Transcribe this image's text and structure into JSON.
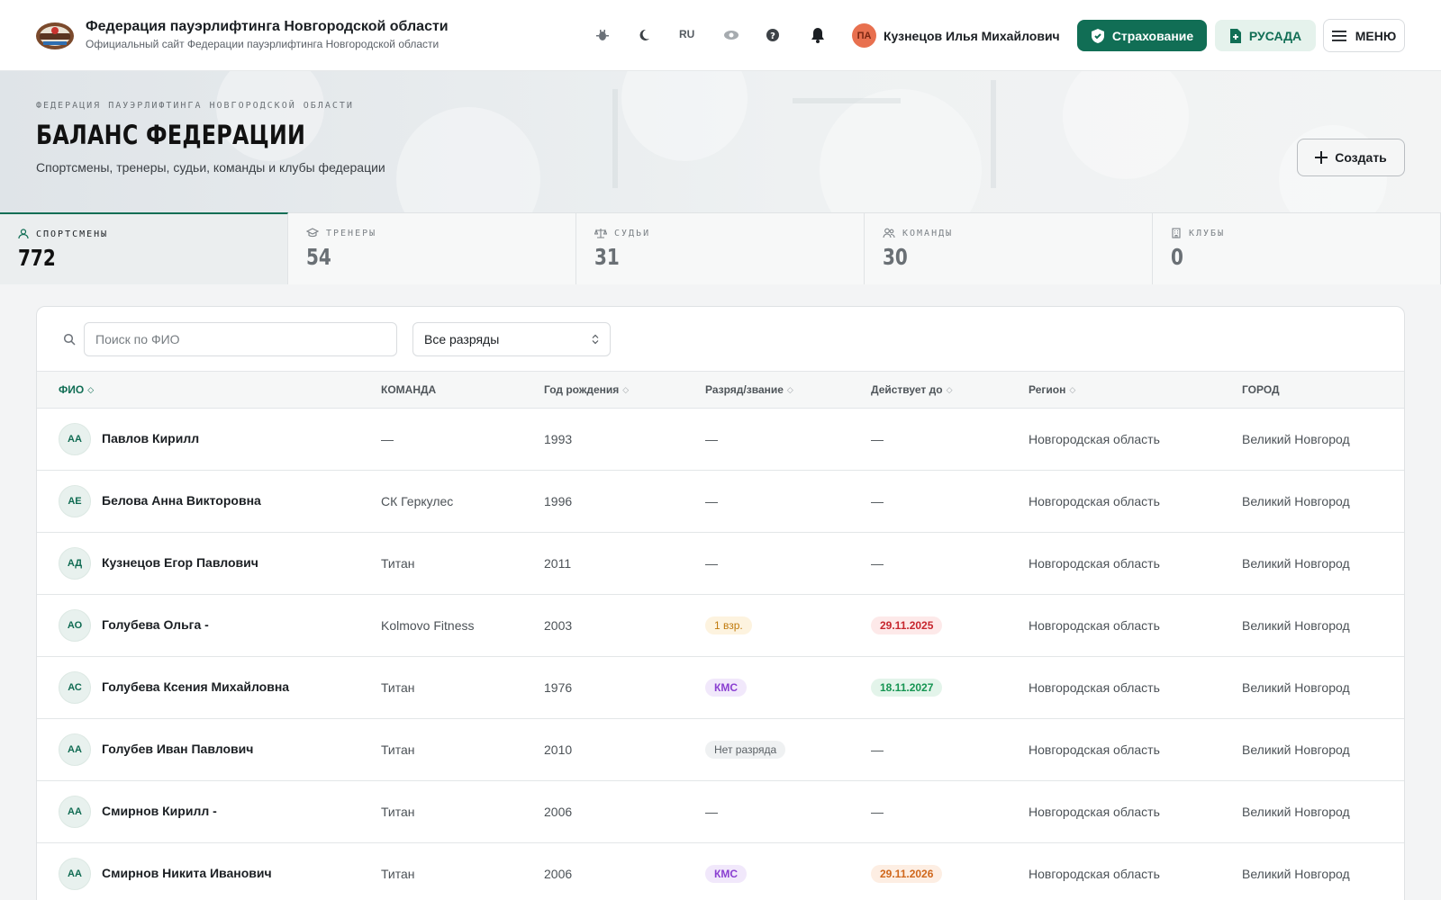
{
  "header": {
    "title": "Федерация пауэрлифтинга Новгородской области",
    "subtitle": "Официальный сайт Федерации пауэрлифтинга Новгородской области",
    "lang": "RU",
    "user_initials": "ПА",
    "user_name": "Кузнецов Илья Михайлович",
    "insurance_label": "Страхование",
    "rusada_label": "РУСАДА",
    "menu_label": "МЕНЮ"
  },
  "hero": {
    "breadcrumb": "ФЕДЕРАЦИЯ ПАУЭРЛИФТИНГА НОВГОРОДСКОЙ ОБЛАСТИ",
    "title": "БАЛАНС ФЕДЕРАЦИИ",
    "subtitle": "Спортсмены, тренеры, судьи, команды и клубы федерации",
    "create_label": "Создать"
  },
  "stats": [
    {
      "label": "СПОРТСМЕНЫ",
      "value": "772",
      "icon": "user-icon"
    },
    {
      "label": "ТРЕНЕРЫ",
      "value": "54",
      "icon": "graduation-cap-icon"
    },
    {
      "label": "СУДЬИ",
      "value": "31",
      "icon": "scales-icon"
    },
    {
      "label": "КОМАНДЫ",
      "value": "30",
      "icon": "users-icon"
    },
    {
      "label": "КЛУБЫ",
      "value": "0",
      "icon": "building-icon"
    }
  ],
  "filters": {
    "search_placeholder": "Поиск по ФИО",
    "rank_select": "Все разряды"
  },
  "table": {
    "columns": [
      "ФИО",
      "КОМАНДА",
      "Год рождения",
      "Разряд/звание",
      "Действует до",
      "Регион",
      "ГОРОД"
    ],
    "rows": [
      {
        "initials": "АА",
        "name": "Павлов Кирилл",
        "team": "—",
        "year": "1993",
        "rank": "—",
        "valid": "—",
        "region": "Новгородская область",
        "city": "Великий Новгород"
      },
      {
        "initials": "АЕ",
        "name": "Белова Анна Викторовна",
        "team": "СК Геркулес",
        "year": "1996",
        "rank": "—",
        "valid": "—",
        "region": "Новгородская область",
        "city": "Великий Новгород"
      },
      {
        "initials": "АД",
        "name": "Кузнецов Егор Павлович",
        "team": "Титан",
        "year": "2011",
        "rank": "—",
        "valid": "—",
        "region": "Новгородская область",
        "city": "Великий Новгород"
      },
      {
        "initials": "АО",
        "name": "Голубева Ольга -",
        "team": "Kolmovo Fitness",
        "year": "2003",
        "rank": "1 взр.",
        "rank_style": "v1",
        "valid": "29.11.2025",
        "valid_style": "red",
        "region": "Новгородская область",
        "city": "Великий Новгород"
      },
      {
        "initials": "АС",
        "name": "Голубева Ксения Михайловна",
        "team": "Титан",
        "year": "1976",
        "rank": "КМС",
        "rank_style": "kms",
        "valid": "18.11.2027",
        "valid_style": "green",
        "region": "Новгородская область",
        "city": "Великий Новгород"
      },
      {
        "initials": "АА",
        "name": "Голубев Иван Павлович",
        "team": "Титан",
        "year": "2010",
        "rank": "Нет разряда",
        "rank_style": "none",
        "valid": "—",
        "region": "Новгородская область",
        "city": "Великий Новгород"
      },
      {
        "initials": "АА",
        "name": "Смирнов Кирилл -",
        "team": "Титан",
        "year": "2006",
        "rank": "—",
        "valid": "—",
        "region": "Новгородская область",
        "city": "Великий Новгород"
      },
      {
        "initials": "АА",
        "name": "Смирнов Никита Иванович",
        "team": "Титан",
        "year": "2006",
        "rank": "КМС",
        "rank_style": "kms",
        "valid": "29.11.2026",
        "valid_style": "orange",
        "region": "Новгородская область",
        "city": "Великий Новгород"
      }
    ]
  },
  "colors": {
    "accent": "#116e55",
    "kms": "#8a3fd1",
    "expired": "#c7262e",
    "valid": "#169552",
    "warning": "#d0671b"
  }
}
